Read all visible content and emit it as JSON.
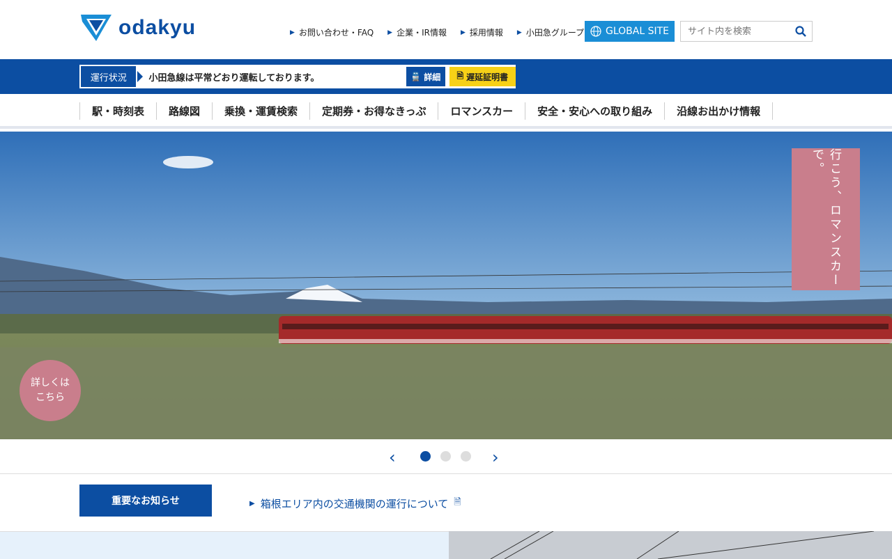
{
  "brand": {
    "logo_text": "odakyu"
  },
  "utility_links": [
    "お問い合わせ・FAQ",
    "企業・IR情報",
    "採用情報",
    "小田急グループ"
  ],
  "global_site": "GLOBAL SITE",
  "search": {
    "placeholder": "サイト内を検索"
  },
  "operation": {
    "tag": "運行状況",
    "message": "小田急線は平常どおり運転しております。",
    "detail": "詳細",
    "delay_cert": "遅延証明書"
  },
  "gnav": [
    "駅・時刻表",
    "路線図",
    "乗換・運賃検索",
    "定期券・お得なきっぷ",
    "ロマンスカー",
    "安全・安心への取り組み",
    "沿線お出かけ情報"
  ],
  "hero": {
    "tagline": "行こう、ロマンスカーで。",
    "more_line1": "詳しくは",
    "more_line2": "こちら",
    "current_slide": 1,
    "slide_count": 3
  },
  "notice": {
    "button": "重要なお知らせ",
    "link": "箱根エリア内の交通機関の運行について"
  },
  "colors": {
    "brand": "#0c4ea2",
    "global": "#1a8ed6",
    "delay": "#f7d117",
    "accent_pink": "#c97e8c"
  }
}
